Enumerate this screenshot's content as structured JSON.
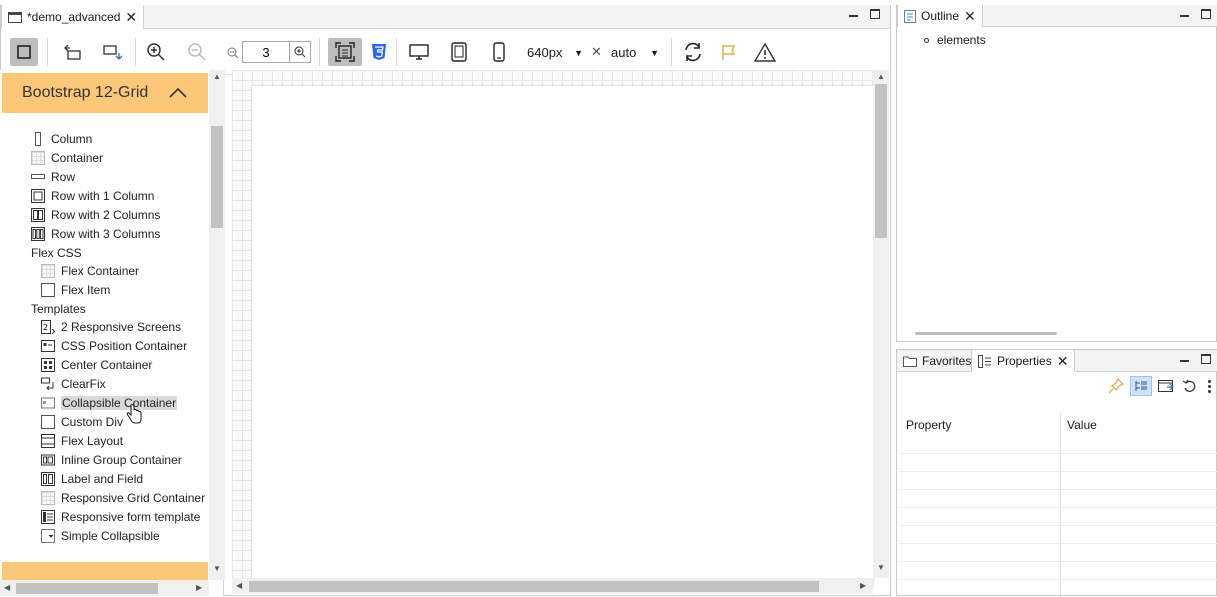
{
  "editor": {
    "tab_title": "*demo_advanced",
    "zoom_value": "3",
    "width_value": "640px",
    "height_value": "auto",
    "times_symbol": "✕"
  },
  "palette": {
    "category_title": "Bootstrap 12-Grid",
    "items_group1": [
      {
        "label": "Column"
      },
      {
        "label": "Container"
      },
      {
        "label": "Row"
      },
      {
        "label": "Row with 1 Column"
      },
      {
        "label": "Row with 2 Columns"
      },
      {
        "label": "Row with 3 Columns"
      }
    ],
    "group_flex": "Flex CSS",
    "items_flex": [
      {
        "label": "Flex Container"
      },
      {
        "label": "Flex Item"
      }
    ],
    "group_templates": "Templates",
    "items_templates": [
      {
        "label": "2 Responsive Screens"
      },
      {
        "label": "CSS Position Container"
      },
      {
        "label": "Center Container"
      },
      {
        "label": "ClearFix"
      },
      {
        "label": "Collapsible Container"
      },
      {
        "label": "Custom Div"
      },
      {
        "label": "Flex Layout"
      },
      {
        "label": "Inline Group Container"
      },
      {
        "label": "Label and Field"
      },
      {
        "label": "Responsive Grid Container"
      },
      {
        "label": "Responsive form template"
      },
      {
        "label": "Simple Collapsible"
      }
    ]
  },
  "outline": {
    "tab_title": "Outline",
    "root_item": "elements"
  },
  "properties": {
    "favorites_tab": "Favorites",
    "properties_tab": "Properties",
    "col_property": "Property",
    "col_value": "Value"
  },
  "colors": {
    "palette_category": "#fbc87a",
    "selected_item": "#d9d9d9",
    "toolbar_active": "#bdbdbd"
  }
}
